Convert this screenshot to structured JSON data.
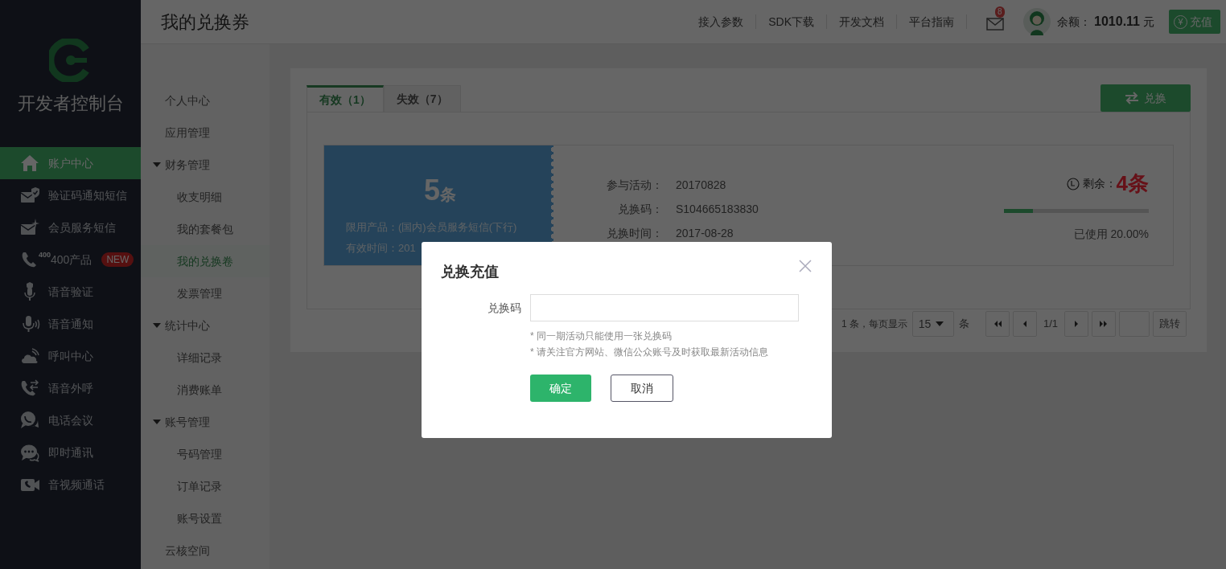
{
  "logo": {
    "title": "开发者控制台"
  },
  "sidebar": {
    "items": [
      {
        "label": "账户中心",
        "selected": true
      },
      {
        "label": "验证码通知短信",
        "selected": false
      },
      {
        "label": "会员服务短信",
        "selected": false
      },
      {
        "label": "400产品",
        "selected": false,
        "badge": "NEW",
        "icon_text": "400"
      },
      {
        "label": "语音验证",
        "selected": false
      },
      {
        "label": "语音通知",
        "selected": false
      },
      {
        "label": "呼叫中心",
        "selected": false
      },
      {
        "label": "语音外呼",
        "selected": false
      },
      {
        "label": "电话会议",
        "selected": false
      },
      {
        "label": "即时通讯",
        "selected": false
      },
      {
        "label": "音视频通话",
        "selected": false
      }
    ]
  },
  "header": {
    "title": "我的兑换券",
    "links": [
      "接入参数",
      "SDK下载",
      "开发文档",
      "平台指南"
    ],
    "mail_badge": "8",
    "balance_label": "余额：",
    "balance": "1010.11",
    "currency": "元",
    "recharge_button": {
      "icon": "¥",
      "label": "充值"
    }
  },
  "subnav": {
    "items": [
      {
        "label": "个人中心",
        "selected": false
      },
      {
        "label": "应用管理",
        "selected": false
      },
      {
        "label": "财务管理",
        "expanded": true,
        "children": [
          {
            "label": "收支明细",
            "selected": false
          },
          {
            "label": "我的套餐包",
            "selected": false
          },
          {
            "label": "我的兑换卷",
            "selected": true
          },
          {
            "label": "发票管理",
            "selected": false
          }
        ]
      },
      {
        "label": "统计中心",
        "expanded": true,
        "children": [
          {
            "label": "详细记录",
            "selected": false
          },
          {
            "label": "消费账单",
            "selected": false
          }
        ]
      },
      {
        "label": "账号管理",
        "expanded": true,
        "children": [
          {
            "label": "号码管理",
            "selected": false
          },
          {
            "label": "订单记录",
            "selected": false
          },
          {
            "label": "账号设置",
            "selected": false
          }
        ]
      },
      {
        "label": "云核空间",
        "selected": false
      }
    ]
  },
  "tabs": [
    {
      "label": "有效（1）",
      "selected": true
    },
    {
      "label": "失效（7）",
      "selected": false
    }
  ],
  "exchange_button": "兑换",
  "coupon": {
    "amount": "5",
    "unit": "条",
    "product": "限用产品：(国内)会员服务短信(下行)",
    "validity": "有效时间：201",
    "fields": [
      {
        "label": "参与活动：",
        "value": "20170828"
      },
      {
        "label": "兑换码：",
        "value": "S104665183830"
      },
      {
        "label": "兑换时间：",
        "value": "2017-08-28"
      }
    ],
    "remaining_label": "剩余：",
    "remaining": "4条",
    "level": 0.2,
    "used": "已使用 20.00%"
  },
  "pagination": {
    "summary": "1 条，每页显示",
    "page_size": "15",
    "unit": "条",
    "page": "1/1",
    "jump": "跳转"
  },
  "dialog": {
    "title": "兑换充值",
    "field_label": "兑换码",
    "notes": [
      "* 同一期活动只能使用一张兑换码",
      "* 请关注官方网站、微信公众账号及时获取最新活动信息"
    ],
    "buttons": [
      {
        "label": "确定",
        "kind": "primary"
      },
      {
        "label": "取消",
        "kind": "secondary"
      }
    ]
  }
}
